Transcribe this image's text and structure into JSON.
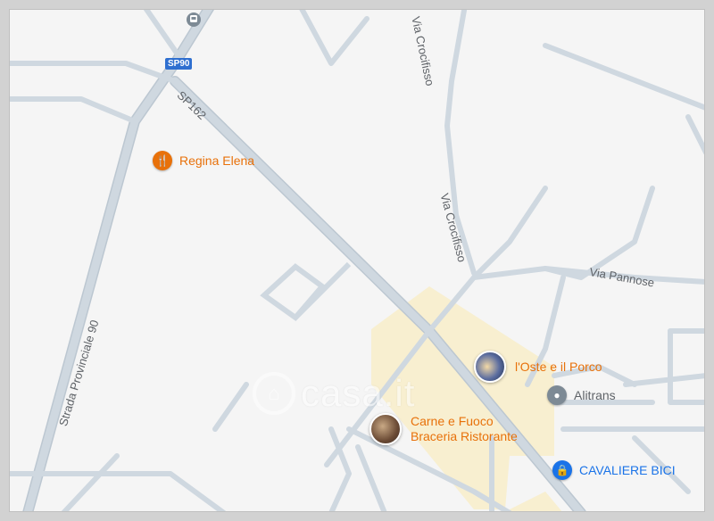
{
  "map": {
    "roads": {
      "sp90": "SP90",
      "sp162": "SP162",
      "via_crocifisso_top": "Via Crocifisso",
      "via_crocifisso_mid": "Via Crocifisso",
      "via_pannose": "Via Pannose",
      "strada_provinciale_90": "Strada Provinciale 90"
    },
    "pois": {
      "regina_elena": {
        "label": "Regina Elena",
        "icon": "restaurant-icon"
      },
      "oste_porco": {
        "label": "l'Oste e il Porco",
        "icon": "photo-thumbnail"
      },
      "alitrans": {
        "label": "Alitrans",
        "icon": "place-pin-icon"
      },
      "carne_fuoco": {
        "line1": "Carne e Fuoco",
        "line2": "Braceria Ristorante",
        "icon": "photo-thumbnail"
      },
      "cavaliere_bici": {
        "label": "CAVALIERE BICI",
        "icon": "shopping-bag-icon"
      }
    },
    "watermark": "casa.it",
    "colors": {
      "restaurant": "#e8710a",
      "shop": "#1a73e8",
      "neutral_pin": "#7d8a95",
      "road": "#cfd8e0",
      "highlight_area": "#f8edc9"
    }
  }
}
